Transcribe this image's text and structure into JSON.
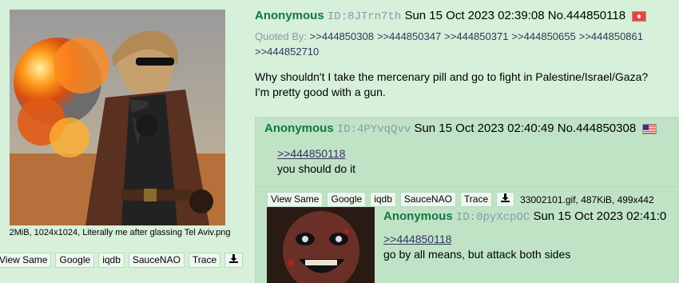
{
  "op": {
    "file_info_line": "2MiB, 1024x1024, Literally me after glassing Tel Aviv.png",
    "image_tools": [
      "View Same",
      "Google",
      "iqdb",
      "SauceNAO",
      "Trace"
    ],
    "name": "Anonymous",
    "id": "ID:8JTrn7th",
    "datetime": "Sun 15 Oct 2023 02:39:08",
    "post_no": "No.444850118",
    "flag": "flag-icon",
    "quoted_by_label": "Quoted By:",
    "quoted_by": [
      ">>444850308",
      ">>444850347",
      ">>444850371",
      ">>444850655",
      ">>444850861",
      ">>444852710"
    ],
    "comment_1": "Why shouldn't I take the mercenary pill and go to fight in Palestine/Israel/Gaza?",
    "comment_2": "I'm pretty good with a gun."
  },
  "reply1": {
    "name": "Anonymous",
    "id": "ID:4PYvqQvv",
    "datetime": "Sun 15 Oct 2023 02:40:49",
    "post_no": "No.444850308",
    "quote": ">>444850118",
    "comment": "you should do it"
  },
  "reply2": {
    "image_tools": [
      "View Same",
      "Google",
      "iqdb",
      "SauceNAO",
      "Trace"
    ],
    "file_info": "33002101.gif, 487KiB, 499x442",
    "name": "Anonymous",
    "id": "ID:0pyXcpOC",
    "datetime": "Sun 15 Oct 2023 02:41:0",
    "quote": ">>444850118",
    "comment": "go by all means, but attack both sides"
  },
  "colors": {
    "background": "#d6f0da",
    "reply_background": "#c0e3c6",
    "name": "#117743",
    "link": "#34345c",
    "meta": "#8899aa"
  }
}
